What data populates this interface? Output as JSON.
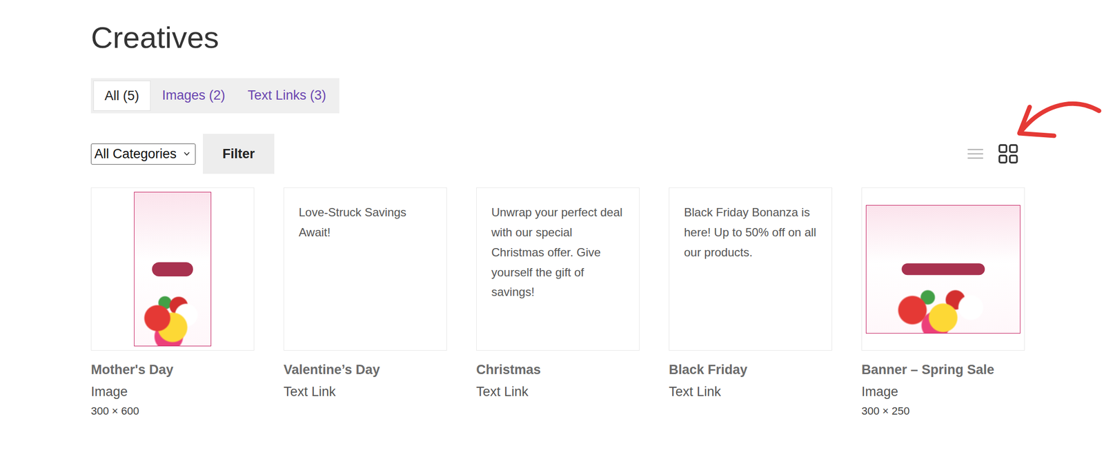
{
  "page": {
    "title": "Creatives"
  },
  "tabs": [
    {
      "label": "All (5)",
      "selected": true
    },
    {
      "label": "Images (2)",
      "selected": false
    },
    {
      "label": "Text Links (3)",
      "selected": false
    }
  ],
  "filter": {
    "category": "All Categories",
    "button": "Filter"
  },
  "view_toggle": [
    {
      "view": "list",
      "selected": false
    },
    {
      "view": "grid",
      "selected": true
    }
  ],
  "creatives": [
    {
      "name": "Mother's Day",
      "type": "Image",
      "kind": "image",
      "size": "300 × 600"
    },
    {
      "name": "Valentine’s Day",
      "type": "Text Link",
      "kind": "text",
      "text": "Love-Struck Savings Await!"
    },
    {
      "name": "Christmas",
      "type": "Text Link",
      "kind": "text",
      "text": "Unwrap your perfect deal with our special Christmas offer. Give yourself the gift of savings!"
    },
    {
      "name": "Black Friday",
      "type": "Text Link",
      "kind": "text",
      "text": "Black Friday Bonanza is here! Up to 50% off on all our products."
    },
    {
      "name": "Banner – Spring Sale",
      "type": "Image",
      "kind": "image",
      "size": "300 × 250"
    }
  ]
}
